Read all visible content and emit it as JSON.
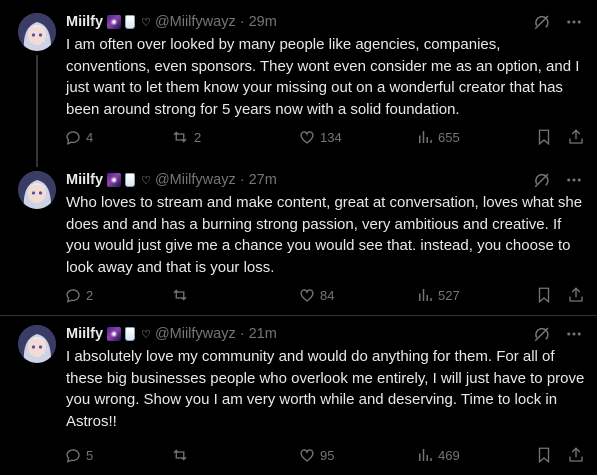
{
  "posts": [
    {
      "display_name": "Miilfy",
      "heart": "♡",
      "handle": "@Miilfywayz",
      "separator": "·",
      "time": "29m",
      "text": "I am often over looked by many people like agencies, companies, conventions, even sponsors. They wont even consider me as an option, and I just want to let them know your missing out on a wonderful creator that has been around strong for 5 years now with a solid foundation.",
      "replies": "4",
      "reposts": "2",
      "likes": "134",
      "views": "655"
    },
    {
      "display_name": "Miilfy",
      "heart": "♡",
      "handle": "@Miilfywayz",
      "separator": "·",
      "time": "27m",
      "text": "Who loves to stream and make content, great at conversation, loves what she does and and has a burning strong passion, very ambitious and creative. If you would just give me a chance you would see that. instead, you choose to look away and that is your loss.",
      "replies": "2",
      "reposts": "",
      "likes": "84",
      "views": "527"
    },
    {
      "display_name": "Miilfy",
      "heart": "♡",
      "handle": "@Miilfywayz",
      "separator": "·",
      "time": "21m",
      "text": "I absolutely love my community and would do anything for them. For all of these big businesses people who overlook me entirely, I will just have to prove you wrong. Show you I am very worth while and deserving. Time to lock in Astros!!",
      "replies": "5",
      "reposts": "",
      "likes": "95",
      "views": "469"
    }
  ],
  "icons": {
    "name_emojis": [
      "galaxy-emoji",
      "milk-glass-emoji",
      "white-heart-emoji"
    ],
    "top": [
      "grok-icon",
      "more-icon"
    ],
    "actions": [
      "reply-icon",
      "repost-icon",
      "like-icon",
      "views-icon",
      "bookmark-icon",
      "share-icon"
    ]
  },
  "colors": {
    "background": "#000000",
    "text": "#e7e9ea",
    "secondary": "#71767b",
    "thread_line": "#333639",
    "divider": "#2f3336"
  }
}
